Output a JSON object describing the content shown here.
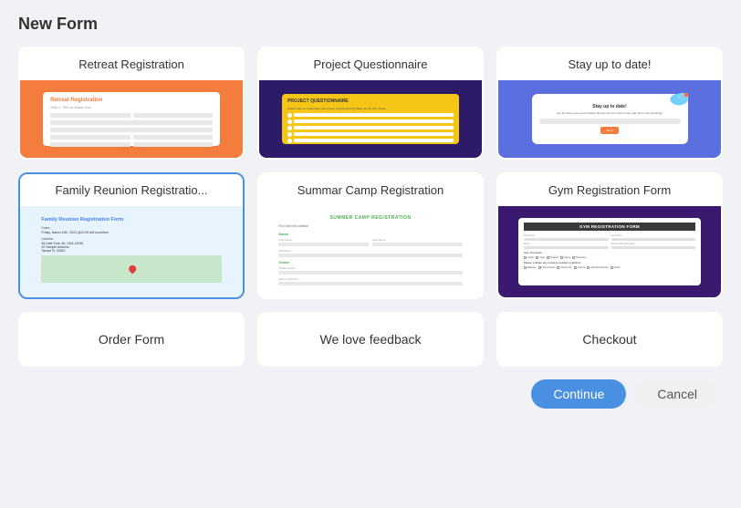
{
  "page": {
    "title": "New Form"
  },
  "cards": {
    "row1": [
      {
        "id": "retreat-registration",
        "label": "Retreat Registration",
        "selected": false
      },
      {
        "id": "project-questionnaire",
        "label": "Project Questionnaire",
        "selected": false
      },
      {
        "id": "stay-up-to-date",
        "label": "Stay up to date!",
        "selected": false
      }
    ],
    "row2": [
      {
        "id": "family-reunion",
        "label": "Family Reunion Registratio...",
        "selected": true
      },
      {
        "id": "summer-camp",
        "label": "Summar Camp Registration",
        "selected": false
      },
      {
        "id": "gym-registration",
        "label": "Gym Registration Form",
        "selected": false
      }
    ],
    "row3": [
      {
        "id": "order-form",
        "label": "Order Form",
        "selected": false
      },
      {
        "id": "we-love-feedback",
        "label": "We love feedback",
        "selected": false
      },
      {
        "id": "checkout",
        "label": "Checkout",
        "selected": false
      }
    ]
  },
  "footer": {
    "continue_label": "Continue",
    "cancel_label": "Cancel"
  }
}
